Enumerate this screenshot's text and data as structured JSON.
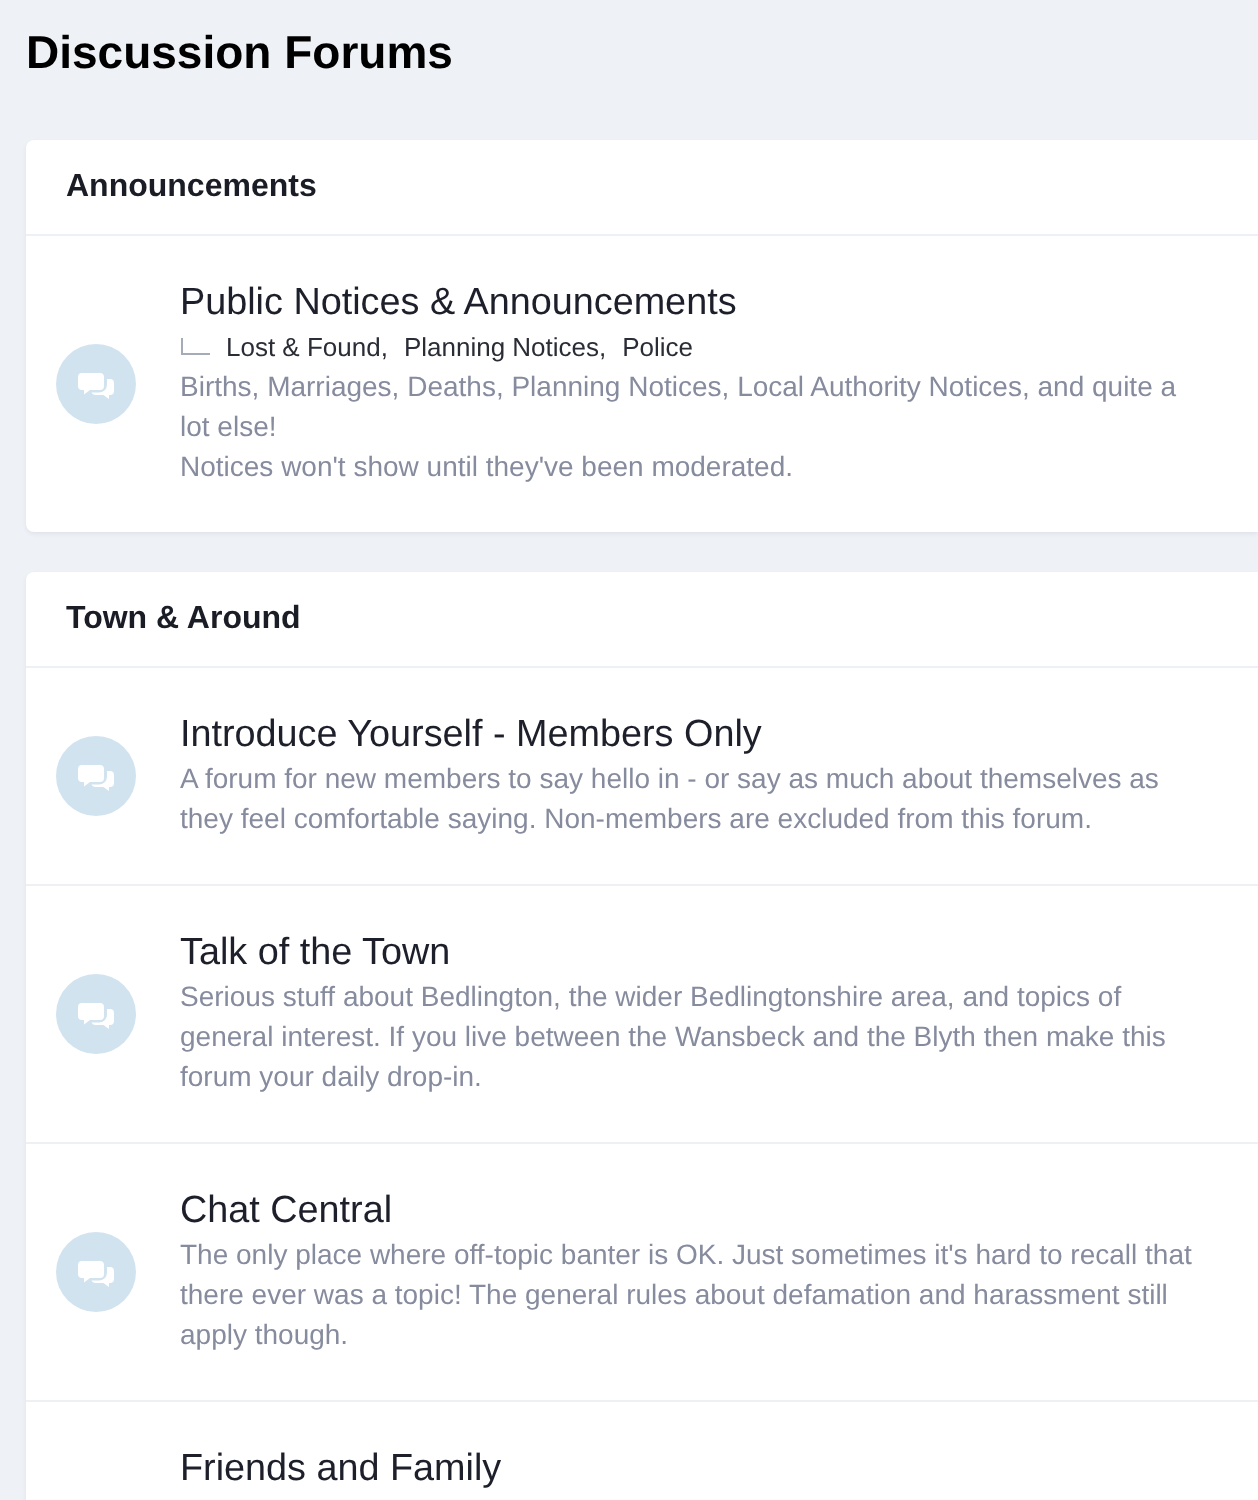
{
  "page": {
    "title": "Discussion Forums"
  },
  "categories": [
    {
      "title": "Announcements",
      "forums": [
        {
          "title": "Public Notices & Announcements",
          "subforums": [
            "Lost & Found,",
            "Planning Notices,",
            "Police"
          ],
          "description": [
            "Births, Marriages, Deaths, Planning Notices, Local Authority Notices, and quite a lot else!",
            "Notices won't show until they've been moderated."
          ]
        }
      ]
    },
    {
      "title": "Town & Around",
      "forums": [
        {
          "title": "Introduce Yourself - Members Only",
          "description": [
            "A forum for new members to say hello in - or say as much about themselves as they feel comfortable saying. Non-members are excluded from this forum."
          ]
        },
        {
          "title": "Talk of the Town",
          "description": [
            "Serious stuff about Bedlington, the wider Bedlingtonshire area, and topics of general interest. If you live between the Wansbeck and the Blyth then make this forum your daily drop-in."
          ]
        },
        {
          "title": "Chat Central",
          "description": [
            "The only place where off-topic banter is OK. Just sometimes it's hard to recall that there ever was a topic! The general rules about defamation and harassment still apply though."
          ]
        },
        {
          "title": "Friends and Family"
        }
      ]
    }
  ]
}
